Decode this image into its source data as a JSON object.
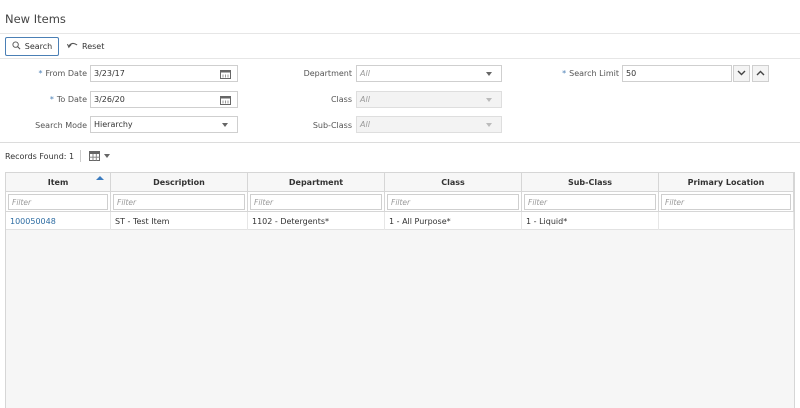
{
  "page": {
    "title": "New Items"
  },
  "toolbar": {
    "search_label": "Search",
    "reset_label": "Reset"
  },
  "form": {
    "from_date": {
      "label": "From Date",
      "value": "3/23/17"
    },
    "to_date": {
      "label": "To Date",
      "value": "3/26/20"
    },
    "search_mode": {
      "label": "Search Mode",
      "value": "Hierarchy"
    },
    "department": {
      "label": "Department",
      "placeholder": "All"
    },
    "class": {
      "label": "Class",
      "placeholder": "All"
    },
    "sub_class": {
      "label": "Sub-Class",
      "placeholder": "All"
    },
    "search_limit": {
      "label": "Search Limit",
      "value": "50"
    },
    "required_mark": "*"
  },
  "results": {
    "records_found": "Records Found: 1"
  },
  "table": {
    "columns": [
      "Item",
      "Description",
      "Department",
      "Class",
      "Sub-Class",
      "Primary Location"
    ],
    "filter_placeholder": "Filter",
    "rows": [
      {
        "item": "100050048",
        "description": "ST - Test Item",
        "department": "1102 - Detergents*",
        "class": "1 - All Purpose*",
        "sub_class": "1 - Liquid*",
        "primary_location": ""
      }
    ]
  },
  "colors": {
    "accent": "#4a7fb5",
    "link": "#2d6ca2",
    "sort": "#3a7bbf"
  },
  "icons": [
    "search-icon",
    "reset-icon",
    "calendar-icon",
    "chevron-down-icon",
    "chevron-up-icon",
    "grid-view-icon",
    "sort-ascending-icon"
  ]
}
